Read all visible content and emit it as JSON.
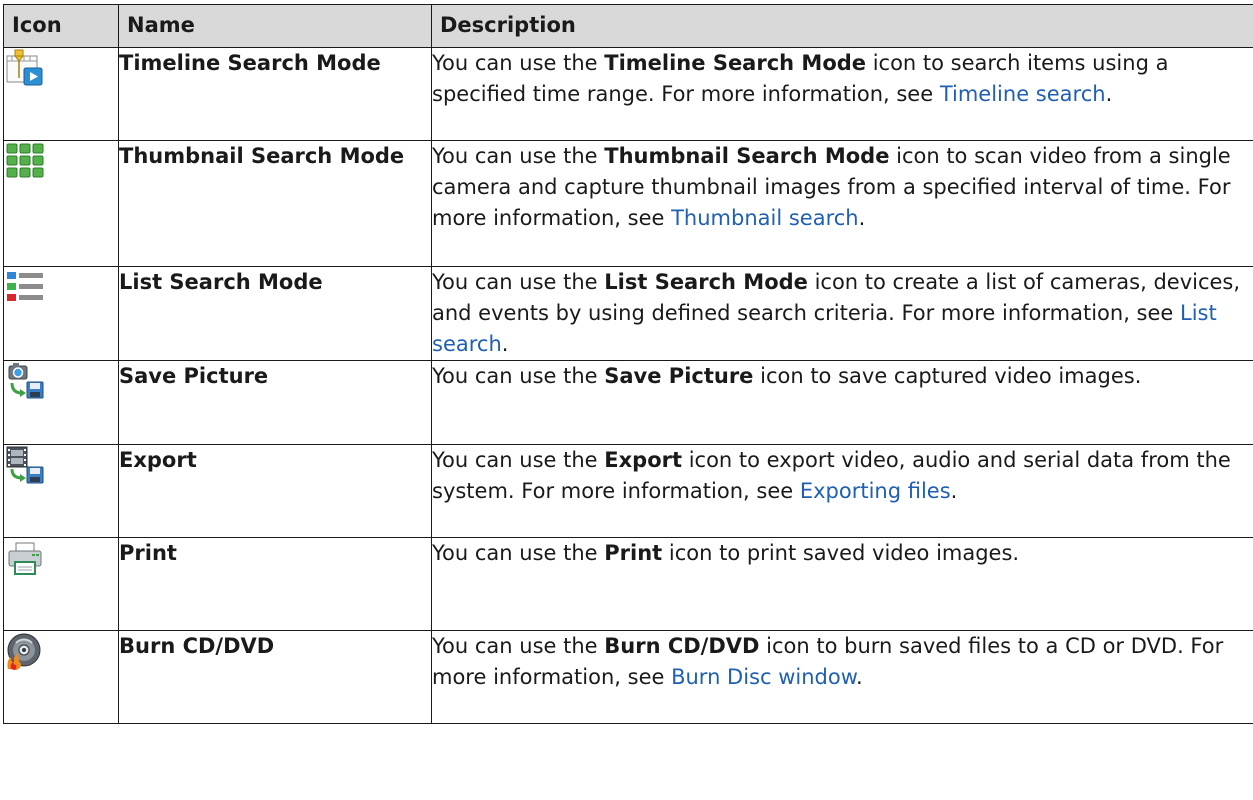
{
  "headers": {
    "icon": "Icon",
    "name": "Name",
    "description": "Description"
  },
  "rows": [
    {
      "icon": "timeline-search-icon",
      "name": "Timeline Search Mode",
      "d_pre": "You can use the ",
      "d_bold": "Timeline Search Mode",
      "d_mid": " icon to search items using a specified time range. For more information, see ",
      "d_link": "Timeline search",
      "d_post": "."
    },
    {
      "icon": "thumbnail-grid-icon",
      "name": "Thumbnail Search Mode",
      "d_pre": "You can use the ",
      "d_bold": "Thumbnail Search Mode",
      "d_mid": " icon to scan video from a single camera and capture thumbnail images from a specified interval of time. For more information, see ",
      "d_link": "Thumbnail search",
      "d_post": "."
    },
    {
      "icon": "list-search-icon",
      "name": "List Search Mode",
      "d_pre": "You can use the ",
      "d_bold": "List Search Mode",
      "d_mid": " icon to create a list of cameras, devices, and events by using defined search criteria. For more information, see ",
      "d_link": "List search",
      "d_post": "."
    },
    {
      "icon": "save-picture-icon",
      "name": "Save Picture",
      "d_pre": "You can use the ",
      "d_bold": "Save Picture",
      "d_mid": " icon to save captured video images.",
      "d_link": "",
      "d_post": ""
    },
    {
      "icon": "export-film-icon",
      "name": "Export",
      "d_pre": "You can use the ",
      "d_bold": "Export",
      "d_mid": " icon to export video, audio and serial data from the system. For more information, see ",
      "d_link": "Exporting files",
      "d_post": "."
    },
    {
      "icon": "printer-icon",
      "name": "Print",
      "d_pre": "You can use the ",
      "d_bold": "Print",
      "d_mid": " icon to print saved video images.",
      "d_link": "",
      "d_post": ""
    },
    {
      "icon": "burn-disc-icon",
      "name": "Burn CD/DVD",
      "d_pre": "You can use the ",
      "d_bold": "Burn CD/DVD",
      "d_mid": " icon to burn saved files to a CD or DVD. For more information, see ",
      "d_link": "Burn Disc window",
      "d_post": "."
    }
  ],
  "colors": {
    "link": "#1f5fb4",
    "header_bg": "#d9d9d9",
    "border": "#1a1a1a"
  }
}
